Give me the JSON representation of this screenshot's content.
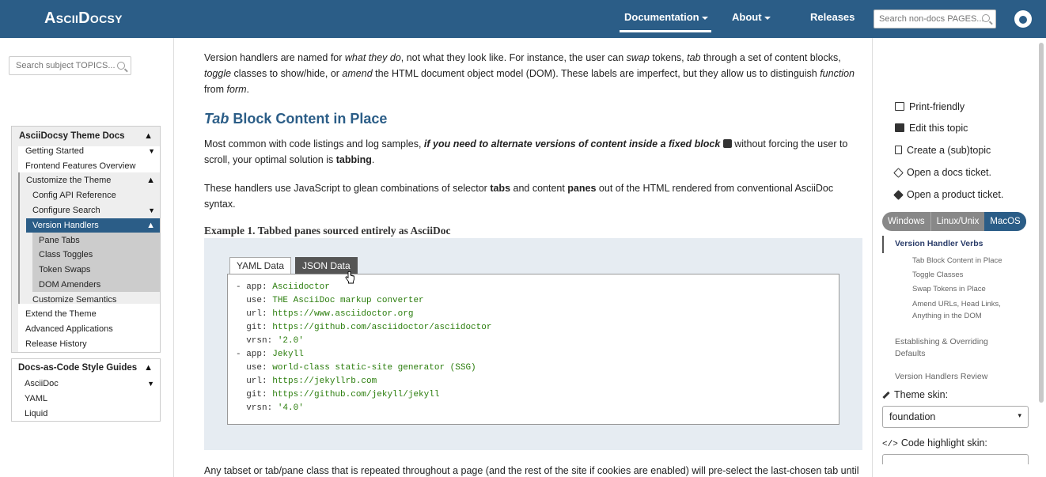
{
  "header": {
    "brand": "AsciiDocsy",
    "nav": [
      {
        "label": "Documentation",
        "dropdown": true,
        "active": true
      },
      {
        "label": "About",
        "dropdown": true
      },
      {
        "label": "Releases"
      }
    ],
    "search_placeholder": "Search non-docs PAGES...",
    "github_icon": "github-icon"
  },
  "left": {
    "search_placeholder": "Search subject TOPICS...",
    "theme_docs": {
      "title": "AsciiDocsy Theme Docs",
      "items": [
        {
          "label": "Getting Started"
        },
        {
          "label": "Frontend Features Overview"
        },
        {
          "label": "Customize the Theme"
        },
        {
          "label": "Config API Reference"
        },
        {
          "label": "Configure Search"
        },
        {
          "label": "Version Handlers"
        },
        {
          "label": "Pane Tabs"
        },
        {
          "label": "Class Toggles"
        },
        {
          "label": "Token Swaps"
        },
        {
          "label": "DOM Amenders"
        },
        {
          "label": "Customize Semantics"
        },
        {
          "label": "Extend the Theme"
        },
        {
          "label": "Advanced Applications"
        },
        {
          "label": "Release History"
        }
      ]
    },
    "style_guides": {
      "title": "Docs-as-Code Style Guides",
      "items": [
        {
          "label": "AsciiDoc"
        },
        {
          "label": "YAML"
        },
        {
          "label": "Liquid"
        }
      ]
    }
  },
  "main": {
    "intro": {
      "t1": "Version handlers are named for ",
      "i1": "what they do",
      "t2": ", not what they look like. For instance, the user can ",
      "i2": "swap",
      "t3": " tokens, ",
      "i3": "tab",
      "t4": " through a set of content blocks, ",
      "i4": "toggle",
      "t5": " classes to show/hide, or ",
      "i5": "amend",
      "t6": " the HTML document object model (DOM). These labels are imperfect, but they allow us to distinguish ",
      "i6": "function",
      "t7": " from ",
      "i7": "form",
      "t8": "."
    },
    "heading": {
      "italic": "Tab",
      "rest": " Block Content in Place"
    },
    "p1": {
      "t1": "Most common with code listings and log samples, ",
      "bi": "if you need to alternate versions of content inside a fixed block",
      "t2": " without forcing the user to scroll, your optimal solution is ",
      "b": "tabbing",
      "t3": "."
    },
    "p2": {
      "t1": "These handlers use JavaScript to glean combinations of selector ",
      "b1": "tabs",
      "t2": " and content ",
      "b2": "panes",
      "t3": " out of the HTML rendered from conventional AsciiDoc syntax."
    },
    "example_title": "Example 1. Tabbed panes sourced entirely as AsciiDoc",
    "tabs": [
      "YAML Data",
      "JSON Data"
    ],
    "code_lines": [
      {
        "pre": "- app: ",
        "val": "Asciidoctor"
      },
      {
        "pre": "  use: ",
        "val": "THE AsciiDoc markup converter"
      },
      {
        "pre": "  url: ",
        "val": "https://www.asciidoctor.org"
      },
      {
        "pre": "  git: ",
        "val": "https://github.com/asciidoctor/asciidoctor"
      },
      {
        "pre": "  vrsn: ",
        "val": "'2.0'"
      },
      {
        "pre": "- app: ",
        "val": "Jekyll"
      },
      {
        "pre": "  use: ",
        "val": "world-class static-site generator (SSG)"
      },
      {
        "pre": "  url: ",
        "val": "https://jekyllrb.com"
      },
      {
        "pre": "  git: ",
        "val": "https://github.com/jekyll/jekyll"
      },
      {
        "pre": "  vrsn: ",
        "val": "'4.0'"
      }
    ],
    "footer_para": "Any tabset or tab/pane class that is repeated throughout a page (and the rest of the site if cookies are enabled) will pre-select the last-chosen tab until"
  },
  "right": {
    "tools": [
      {
        "label": "Print-friendly",
        "icon": "print-icon"
      },
      {
        "label": "Edit this topic",
        "icon": "edit-icon"
      },
      {
        "label": "Create a (sub)topic",
        "icon": "file-icon"
      },
      {
        "label": "Open a docs ticket.",
        "icon": "tag-icon"
      },
      {
        "label": "Open a product ticket.",
        "icon": "tag-icon"
      }
    ],
    "os_tabs": [
      "Windows",
      "Linux/Unix",
      "MacOS"
    ],
    "toc": [
      {
        "label": "Version Handler Verbs",
        "level": 1,
        "current": true
      },
      {
        "label": "Tab Block Content in Place",
        "level": 2
      },
      {
        "label": "Toggle Classes",
        "level": 2
      },
      {
        "label": "Swap Tokens in Place",
        "level": 2
      },
      {
        "label": "Amend URLs, Head Links, Anything in the DOM",
        "level": 2
      },
      {
        "label": "Establishing & Overriding Defaults",
        "level": 1
      },
      {
        "label": "Version Handlers Review",
        "level": 1
      }
    ],
    "theme_skin_label": "Theme skin:",
    "theme_skin_value": "foundation",
    "code_skin_label": "Code highlight skin:"
  },
  "colors": {
    "brand": "#2b5d87",
    "code_value": "#2a7d0c"
  }
}
